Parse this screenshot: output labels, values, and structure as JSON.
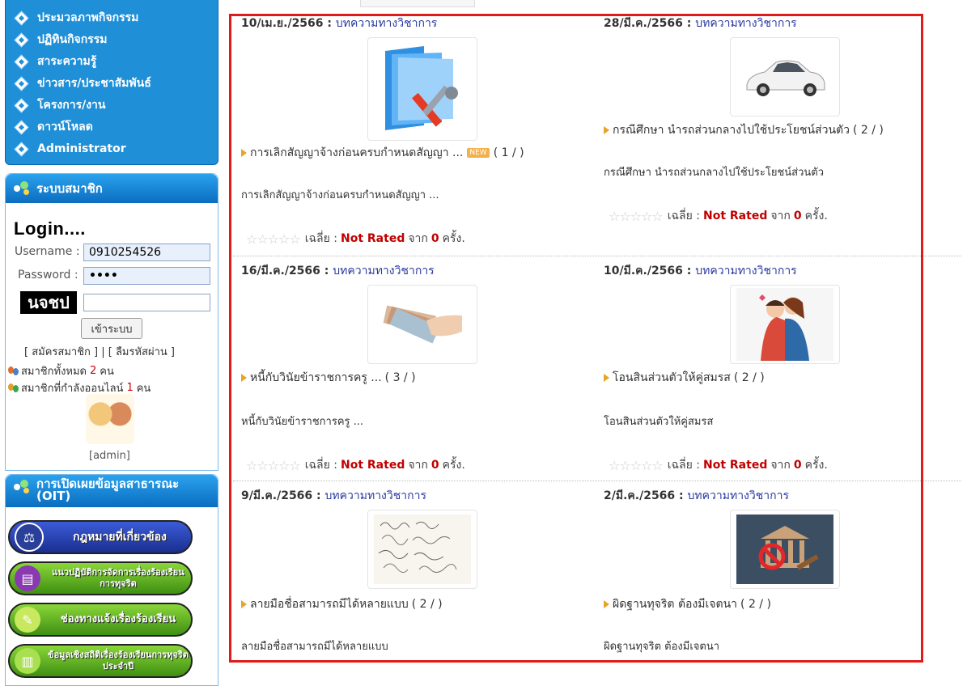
{
  "menu": {
    "items": [
      {
        "label": "ประมวลภาพกิจกรรม"
      },
      {
        "label": "ปฏิทินกิจกรรม"
      },
      {
        "label": "สาระความรู้"
      },
      {
        "label": "ข่าวสาร/ประชาสัมพันธ์"
      },
      {
        "label": "โครงการ/งาน"
      },
      {
        "label": "ดาวน์โหลด"
      },
      {
        "label": "Administrator"
      }
    ]
  },
  "member_panel": {
    "title": "ระบบสมาชิก",
    "login_title": "Login....",
    "username_label": "Username :",
    "username_value": "0910254526",
    "password_label": "Password :",
    "password_value": "••••",
    "captcha_text": "นจชป",
    "captcha_value": "",
    "login_button": "เข้าระบบ",
    "register_links": "[ สมัครสมาชิก ] | [ ลืมรหัสผ่าน ]",
    "total_members_label": "สมาชิกทั้งหมด",
    "total_members_count": "2",
    "total_members_unit": "คน",
    "online_label": "สมาชิกที่กำลังออนไลน์",
    "online_count": "1",
    "online_unit": "คน",
    "admin_name": "[admin]"
  },
  "oit_panel": {
    "title": "การเปิดเผยข้อมูลสาธารณะ (OIT)",
    "buttons": [
      {
        "label": "กฎหมายที่เกี่ยวข้อง"
      },
      {
        "label": "แนวปฏิบัติการจัดการเรื่องร้องเรียนการทุจริต"
      },
      {
        "label": "ช่องทางแจ้งเรื่องร้องเรียน"
      },
      {
        "label": "ข้อมูลเชิงสถิติเรื่องร้องเรียนการทุจริตประจำปี"
      }
    ]
  },
  "articles": [
    {
      "date": "10/เม.ย./2566",
      "category": "บทความทางวิชาการ",
      "title": "การเลิกสัญญาจ้างก่อนครบกำหนดสัญญา ...",
      "badge": "NEW",
      "count": "( 1 / )",
      "desc": "การเลิกสัญญาจ้างก่อนครบกำหนดสัญญา ...",
      "thumb_icon": "folder-tools-icon"
    },
    {
      "date": "28/มี.ค./2566",
      "category": "บทความทางวิชาการ",
      "title": "กรณีศึกษา นำรถส่วนกลางไปใช้ประโยชน์ส่วนตัว",
      "badge": "",
      "count": "( 2 / )",
      "desc": "กรณีศึกษา นำรถส่วนกลางไปใช้ประโยชน์ส่วนตัว",
      "thumb_icon": "car-icon"
    },
    {
      "date": "16/มี.ค./2566",
      "category": "บทความทางวิชาการ",
      "title": "หนี้กับวินัยข้าราชการครู ...",
      "badge": "",
      "count": "( 3 / )",
      "desc": "หนี้กับวินัยข้าราชการครู ...",
      "thumb_icon": "money-hand-icon"
    },
    {
      "date": "10/มี.ค./2566",
      "category": "บทความทางวิชาการ",
      "title": "โอนสินส่วนตัวให้คู่สมรส",
      "badge": "",
      "count": "( 2 / )",
      "desc": "โอนสินส่วนตัวให้คู่สมรส",
      "thumb_icon": "couple-icon"
    },
    {
      "date": "9/มี.ค./2566",
      "category": "บทความทางวิชาการ",
      "title": "ลายมือชื่อสามารถมีได้หลายแบบ",
      "badge": "",
      "count": "( 2 / )",
      "desc": "ลายมือชื่อสามารถมีได้หลายแบบ",
      "thumb_icon": "signature-icon"
    },
    {
      "date": "2/มี.ค./2566",
      "category": "บทความทางวิชาการ",
      "title": "ผิดฐานทุจริต ต้องมีเจตนา",
      "badge": "",
      "count": "( 2 / )",
      "desc": "ผิดฐานทุจริต ต้องมีเจตนา",
      "thumb_icon": "court-icon"
    }
  ],
  "rating": {
    "stars": "☆☆☆☆☆",
    "avg_label": "เฉลี่ย :",
    "not_rated": "Not Rated",
    "from_label": "จาก",
    "times": "0",
    "times_unit": "ครั้ง."
  },
  "colors": {
    "accent": "#1f8fd8",
    "frame": "#e01b1b",
    "category": "#2a3aa0",
    "not_rated": "#c00000"
  }
}
